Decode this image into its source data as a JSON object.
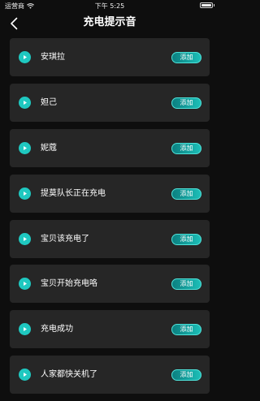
{
  "status_bar": {
    "carrier": "运营商",
    "time": "下午 5:25"
  },
  "header": {
    "title": "充电提示音",
    "back_icon": "chevron-left-icon"
  },
  "colors": {
    "background": "#0e0e0e",
    "card": "#262626",
    "accent": "#1fc8c0"
  },
  "sounds": [
    {
      "name": "安琪拉",
      "action": "添加"
    },
    {
      "name": "妲己",
      "action": "添加"
    },
    {
      "name": "妮蔻",
      "action": "添加"
    },
    {
      "name": "提莫队长正在充电",
      "action": "添加"
    },
    {
      "name": "宝贝该充电了",
      "action": "添加"
    },
    {
      "name": "宝贝开始充电咯",
      "action": "添加"
    },
    {
      "name": "充电成功",
      "action": "添加"
    },
    {
      "name": "人家都快关机了",
      "action": "添加"
    }
  ]
}
